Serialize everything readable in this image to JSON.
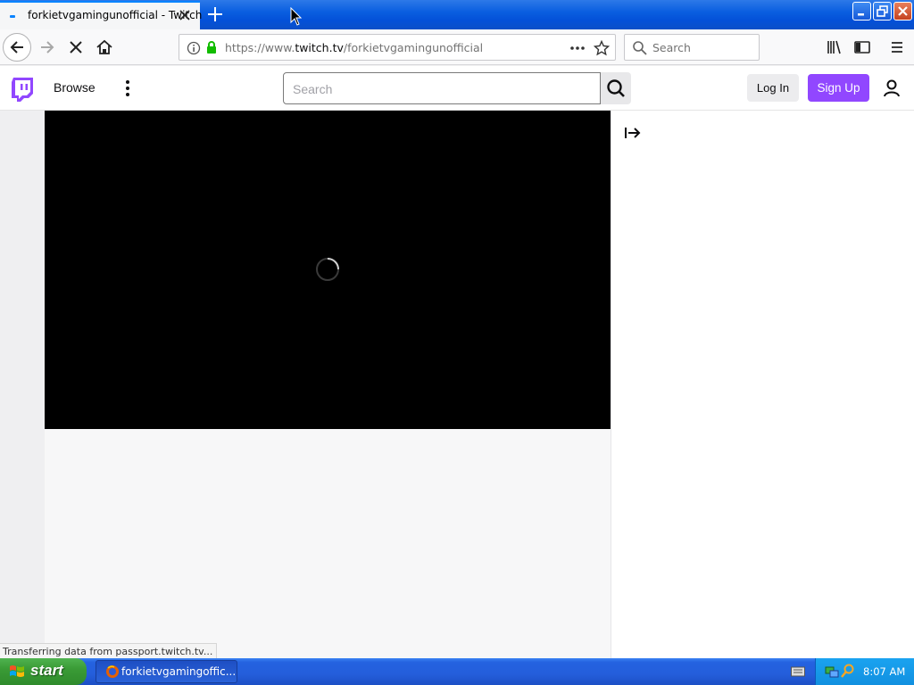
{
  "browser": {
    "tab_title": "forkietvgamingunofficial - Twitch",
    "url_prefix": "https://www.",
    "url_host": "twitch.tv",
    "url_path": "/forkietvgamingunofficial",
    "search_placeholder": "Search",
    "status_text": "Transferring data from passport.twitch.tv..."
  },
  "twitch": {
    "browse_label": "Browse",
    "search_placeholder": "Search",
    "login_label": "Log In",
    "signup_label": "Sign Up",
    "brand_color": "#9147ff"
  },
  "player": {
    "state": "loading"
  },
  "taskbar": {
    "start_label": "start",
    "task_label": "forkietvgamingoffic...",
    "clock": "8:07 AM"
  },
  "icons": {
    "browser": [
      "back-arrow-icon",
      "forward-arrow-icon",
      "stop-icon",
      "home-icon",
      "info-icon",
      "lock-icon",
      "page-actions-icon",
      "bookmark-star-icon",
      "search-icon",
      "library-icon",
      "sidebar-icon",
      "hamburger-menu-icon"
    ],
    "twitch": [
      "twitch-logo-icon",
      "more-dots-icon",
      "search-icon",
      "user-icon",
      "collapse-chat-icon"
    ],
    "tray": [
      "keyboard-icon",
      "network-icon",
      "search-tray-icon"
    ]
  }
}
